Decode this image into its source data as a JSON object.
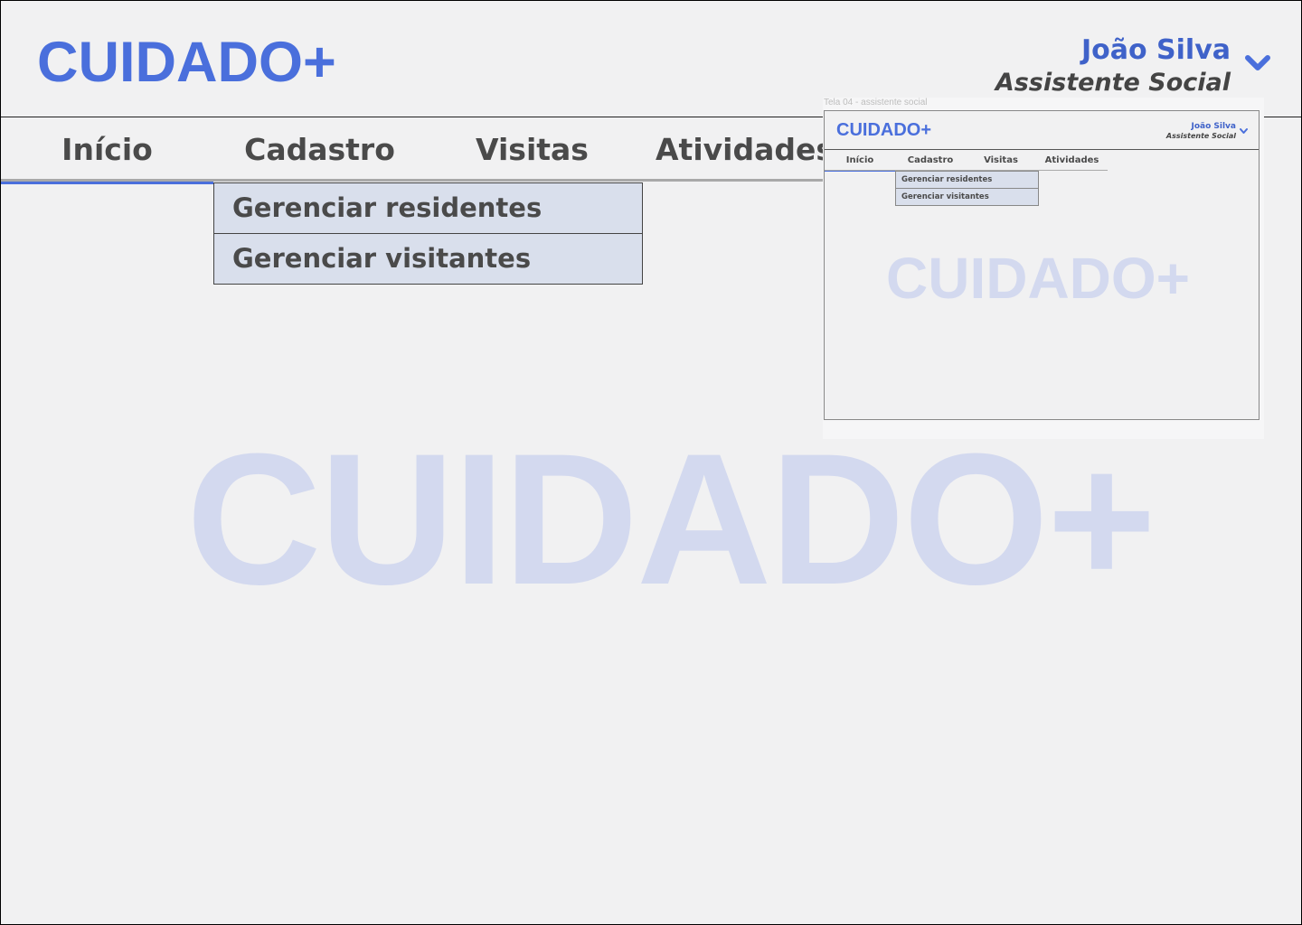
{
  "header": {
    "logo": "CUIDADO+",
    "user": {
      "name": "João Silva",
      "role": "Assistente Social",
      "menu_icon": "chevron-down-icon"
    }
  },
  "nav": {
    "items": [
      {
        "label": "Início",
        "active": true
      },
      {
        "label": "Cadastro",
        "active": false
      },
      {
        "label": "Visitas",
        "active": false
      },
      {
        "label": "Atividades",
        "active": false
      }
    ]
  },
  "dropdown": {
    "parent": "Cadastro",
    "items": [
      {
        "label": "Gerenciar residentes"
      },
      {
        "label": "Gerenciar visitantes"
      }
    ]
  },
  "watermark": "CUIDADO+",
  "thumbnail": {
    "caption": "Tela 04 - assistente social",
    "logo": "CUIDADO+",
    "user_name": "João Silva",
    "user_role": "Assistente Social",
    "nav": [
      "Início",
      "Cadastro",
      "Visitas",
      "Atividades"
    ],
    "dropdown": [
      "Gerenciar residentes",
      "Gerenciar visitantes"
    ],
    "watermark": "CUIDADO+"
  },
  "colors": {
    "brand": "#4a6fdc",
    "background": "#f1f1f2",
    "dropdown_bg": "#d9dfec",
    "watermark": "#d3d9ef",
    "text": "#4a4a4a"
  }
}
